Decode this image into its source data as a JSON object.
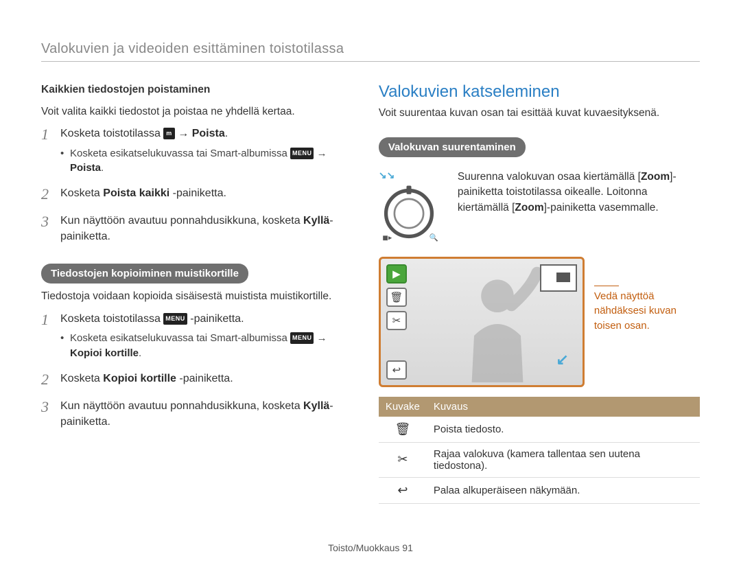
{
  "header": {
    "section_title": "Valokuvien ja videoiden esittäminen toistotilassa"
  },
  "left": {
    "h_delete_all": "Kaikkien tiedostojen poistaminen",
    "delete_all_desc": "Voit valita kaikki tiedostot ja poistaa ne yhdellä kertaa.",
    "steps_delete": {
      "1": {
        "pre": "Kosketa toistotilassa ",
        "badge": "m",
        "post": " → ",
        "bold": "Poista",
        "dot": "."
      },
      "1_sub": {
        "pre": "Kosketa esikatselukuvassa tai Smart-albumissa ",
        "badge": "MENU",
        "post": " → ",
        "bold": "Poista",
        "dot": "."
      },
      "2": {
        "text_pre": "Kosketa ",
        "bold": "Poista kaikki",
        "text_post": " -painiketta."
      },
      "3": {
        "pre": "Kun näyttöön avautuu ponnahdusikkuna, kosketa ",
        "bold": "Kyllä",
        "post": "-painiketta."
      }
    },
    "pill_copy": "Tiedostojen kopioiminen muistikortille",
    "copy_desc": "Tiedostoja voidaan kopioida sisäisestä muistista muistikortille.",
    "steps_copy": {
      "1": {
        "pre": "Kosketa toistotilassa ",
        "badge": "MENU",
        "post": " -painiketta."
      },
      "1_sub": {
        "pre": "Kosketa esikatselukuvassa tai Smart-albumissa ",
        "badge": "MENU",
        "post": " → ",
        "bold": "Kopioi kortille",
        "dot": "."
      },
      "2": {
        "text_pre": "Kosketa ",
        "bold": "Kopioi kortille",
        "text_post": " -painiketta."
      },
      "3": {
        "pre": "Kun näyttöön avautuu ponnahdusikkuna, kosketa ",
        "bold": "Kyllä",
        "post": "-painiketta."
      }
    }
  },
  "right": {
    "h2": "Valokuvien katseleminen",
    "intro": "Voit suurentaa kuvan osan tai esittää kuvat kuvaesityksenä.",
    "pill_zoom": "Valokuvan suurentaminen",
    "zoom_desc": {
      "p1a": "Suurenna valokuvan osaa kiertämällä [",
      "p1b": "Zoom",
      "p1c": "]-painiketta toistotilassa oikealle. Loitonna kiertämällä [",
      "p1d": "Zoom",
      "p1e": "]-painiketta vasemmalle."
    },
    "caption": {
      "l1": "Vedä näyttöä",
      "l2": "nähdäksesi kuvan",
      "l3": "toisen osan."
    },
    "icons": {
      "trash": "🗑",
      "scissors": "✂",
      "back": "↩"
    },
    "table": {
      "th_icon": "Kuvake",
      "th_desc": "Kuvaus",
      "rows": [
        {
          "icon": "🗑",
          "desc": "Poista tiedosto."
        },
        {
          "icon": "✂",
          "desc": "Rajaa valokuva (kamera tallentaa sen uutena tiedostona)."
        },
        {
          "icon": "↩",
          "desc": "Palaa alkuperäiseen näkymään."
        }
      ]
    }
  },
  "footer": {
    "text": "Toisto/Muokkaus  91"
  }
}
